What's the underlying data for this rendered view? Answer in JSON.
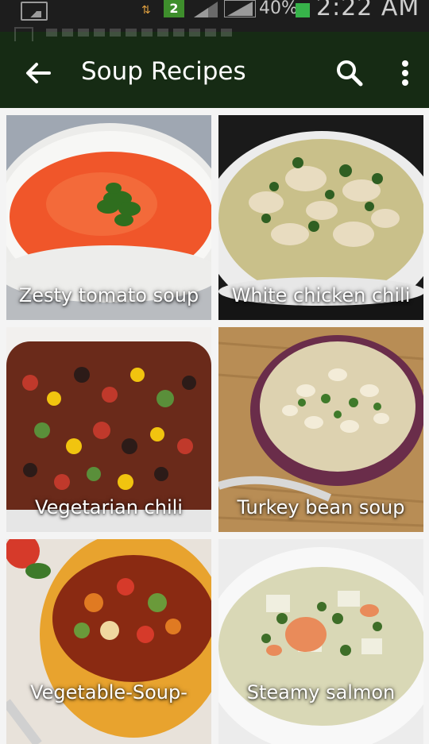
{
  "status_bar": {
    "sim_slot": "2",
    "battery_percent": "40%",
    "time": "2:22 AM",
    "colors": {
      "sim_badge": "#3e8e2c",
      "battery": "#37b34a"
    }
  },
  "app_bar": {
    "title": "Soup Recipes",
    "back_icon": "arrow-left-icon",
    "search_icon": "search-icon",
    "more_icon": "more-vert-icon",
    "color": "#162b14"
  },
  "recipes": [
    {
      "name": "Zesty tomato soup",
      "image": "tomato-soup-bowl"
    },
    {
      "name": "White chicken chili",
      "image": "white-chicken-chili-bowl"
    },
    {
      "name": "Vegetarian chili",
      "image": "vegetarian-chili-dish"
    },
    {
      "name": "Turkey bean soup",
      "image": "turkey-bean-soup-bowl"
    },
    {
      "name": "Vegetable-Soup-",
      "image": "vegetable-soup-bowl"
    },
    {
      "name": "Steamy salmon",
      "image": "salmon-chowder-bowl"
    }
  ]
}
